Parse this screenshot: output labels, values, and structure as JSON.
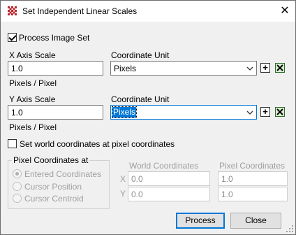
{
  "window": {
    "title": "Set Independent Linear Scales",
    "close_glyph": "✕"
  },
  "process_image_set": {
    "label": "Process Image Set",
    "checked": true
  },
  "x_axis": {
    "label": "X Axis Scale",
    "value": "1.0",
    "unit_text": "Pixels / Pixel",
    "coord_unit_label": "Coordinate Unit",
    "coord_unit_value": "Pixels"
  },
  "y_axis": {
    "label": "Y Axis Scale",
    "value": "1.0",
    "unit_text": "Pixels / Pixel",
    "coord_unit_label": "Coordinate Unit",
    "coord_unit_value": "Pixels"
  },
  "set_world_coords": {
    "label": "Set world coordinates at pixel coordinates",
    "checked": false
  },
  "pixel_coords_group": {
    "title": "Pixel Coordinates at",
    "options": [
      "Entered Coordinates",
      "Cursor Position",
      "Cursor Centroid"
    ],
    "selected_index": 0
  },
  "coord_table": {
    "world_header": "World Coordinates",
    "pixel_header": "Pixel Coordinates",
    "x_label": "X",
    "y_label": "Y",
    "world_x": "0.0",
    "world_y": "0.0",
    "pixel_x": "1.0",
    "pixel_y": "1.0"
  },
  "buttons": {
    "process": "Process",
    "close": "Close",
    "add_glyph": "+",
    "remove_glyph": "✕"
  },
  "icons": {
    "app": "grid-app-icon",
    "accent": "#c0282d"
  }
}
